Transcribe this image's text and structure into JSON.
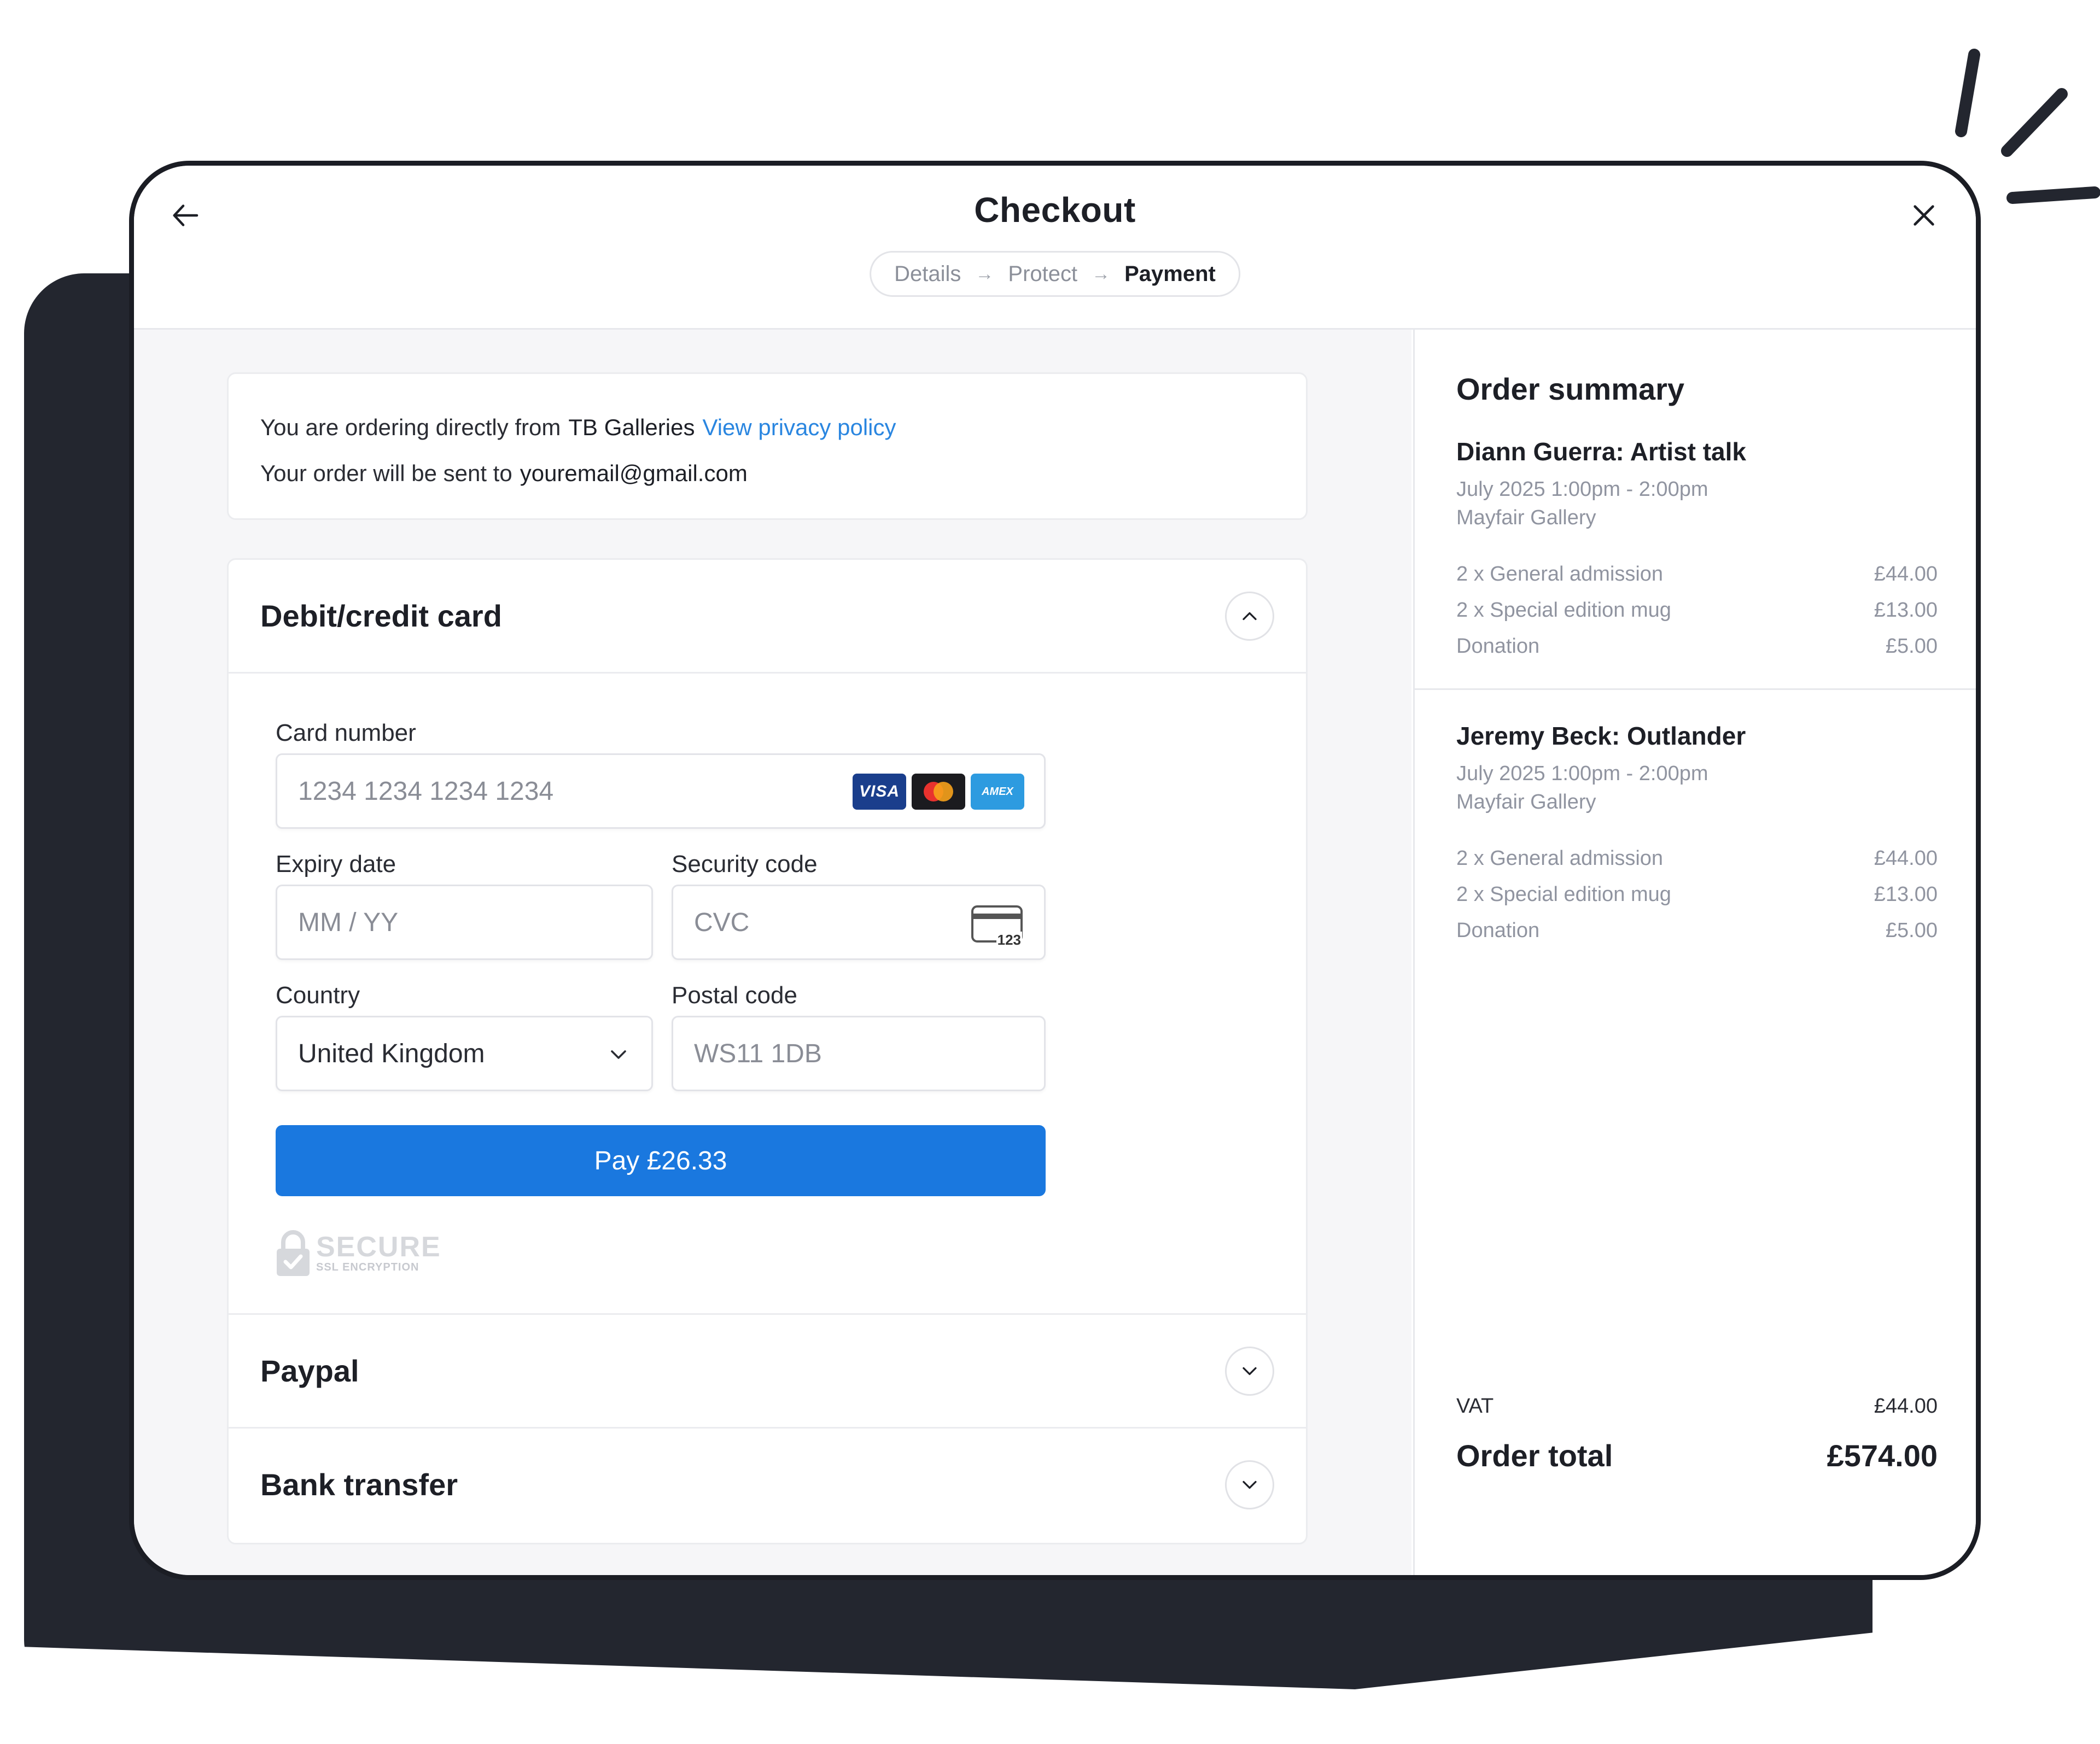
{
  "header": {
    "title": "Checkout",
    "steps": [
      {
        "label": "Details"
      },
      {
        "label": "Protect"
      },
      {
        "label": "Payment"
      }
    ],
    "arrow": "→"
  },
  "info": {
    "ordering_prefix": "You are ordering directly from",
    "merchant": "TB Galleries",
    "privacy_link": "View privacy policy",
    "sent_prefix": "Your order will be sent to",
    "email": "youremail@gmail.com"
  },
  "payment": {
    "card_section": "Debit/credit card",
    "card_number_label": "Card number",
    "card_number_placeholder": "1234 1234 1234 1234",
    "brands": {
      "visa": "VISA",
      "amex": "AMEX"
    },
    "expiry_label": "Expiry date",
    "expiry_placeholder": "MM / YY",
    "security_label": "Security code",
    "security_placeholder": "CVC",
    "cvc_icon_text": "123",
    "country_label": "Country",
    "country_value": "United Kingdom",
    "postal_label": "Postal code",
    "postal_placeholder": "WS11 1DB",
    "pay_label": "Pay £26.33",
    "secure_big": "SECURE",
    "secure_small": "SSL ENCRYPTION",
    "paypal_section": "Paypal",
    "bank_section": "Bank transfer"
  },
  "summary": {
    "title": "Order summary",
    "items": [
      {
        "name": "Diann Guerra: Artist talk",
        "time": "July 2025 1:00pm - 2:00pm",
        "venue": "Mayfair Gallery",
        "lines": [
          {
            "label": "2 x General admission",
            "amount": "£44.00"
          },
          {
            "label": "2 x Special edition mug",
            "amount": "£13.00"
          },
          {
            "label": "Donation",
            "amount": "£5.00"
          }
        ]
      },
      {
        "name": "Jeremy Beck: Outlander",
        "time": "July 2025 1:00pm - 2:00pm",
        "venue": "Mayfair Gallery",
        "lines": [
          {
            "label": "2 x General admission",
            "amount": "£44.00"
          },
          {
            "label": "2 x Special edition mug",
            "amount": "£13.00"
          },
          {
            "label": "Donation",
            "amount": "£5.00"
          }
        ]
      }
    ],
    "vat_label": "VAT",
    "vat_amount": "£44.00",
    "total_label": "Order total",
    "total_amount": "£574.00"
  },
  "colors": {
    "accent": "#1a78df",
    "link": "#2a86e0",
    "backdrop": "#23262f"
  }
}
